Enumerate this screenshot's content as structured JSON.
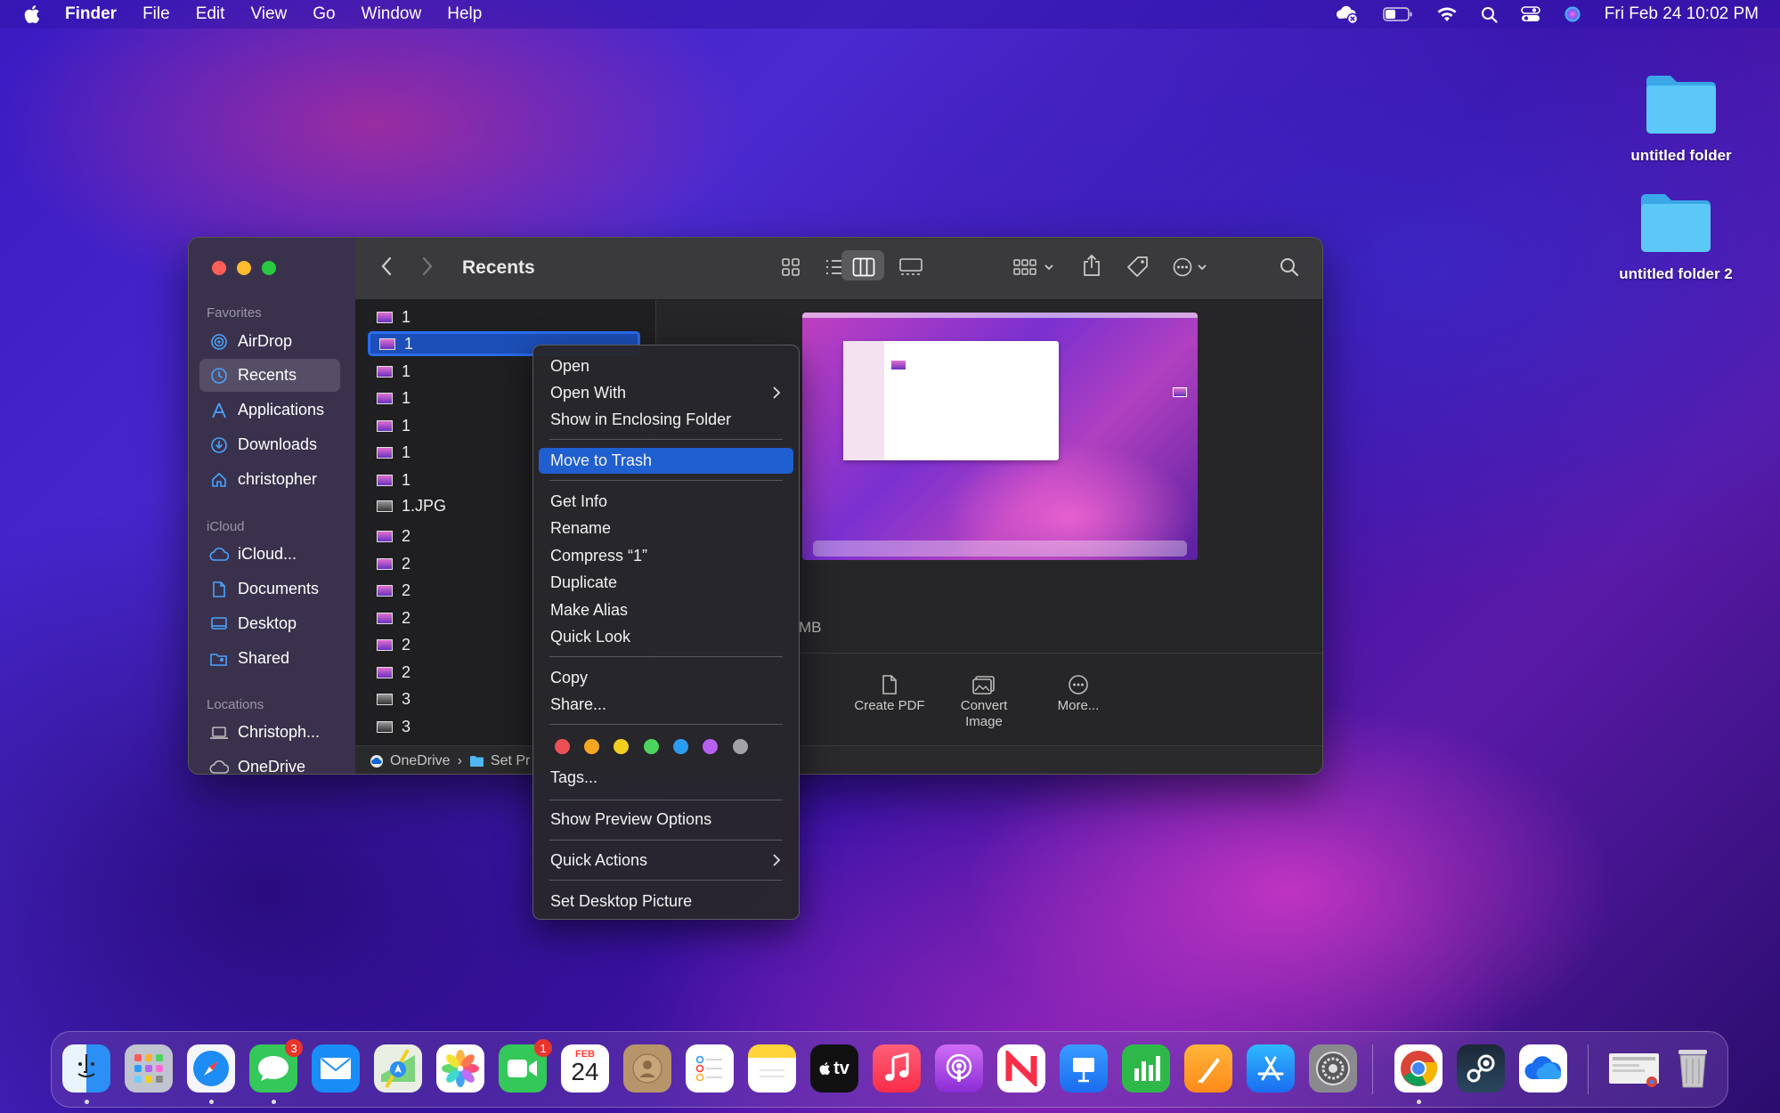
{
  "menubar": {
    "app_name": "Finder",
    "menus": [
      "File",
      "Edit",
      "View",
      "Go",
      "Window",
      "Help"
    ],
    "clock": "Fri Feb 24  10:02 PM"
  },
  "desktop": {
    "folders": [
      "untitled folder",
      "untitled folder 2"
    ]
  },
  "finder": {
    "title": "Recents",
    "sidebar": {
      "sections": {
        "favorites": "Favorites",
        "icloud": "iCloud",
        "locations": "Locations"
      },
      "favorites": [
        "AirDrop",
        "Recents",
        "Applications",
        "Downloads",
        "christopher"
      ],
      "icloud": [
        "iCloud...",
        "Documents",
        "Desktop",
        "Shared"
      ],
      "locations": [
        "Christoph...",
        "OneDrive"
      ]
    },
    "files": [
      "1",
      "1",
      "1",
      "1",
      "1",
      "1",
      "1",
      "1.JPG",
      "2",
      "2",
      "2",
      "2",
      "2",
      "2",
      "3",
      "3"
    ],
    "pathbar": {
      "root": "OneDrive",
      "separator": "›",
      "child": "Set Pr"
    },
    "preview": {
      "info_fragment": "MB",
      "actions": [
        "Create PDF",
        "Convert\nImage",
        "More..."
      ]
    }
  },
  "context_menu": {
    "group1": [
      "Open",
      "Open With",
      "Show in Enclosing Folder"
    ],
    "group2": [
      "Move to Trash"
    ],
    "group3": [
      "Get Info",
      "Rename",
      "Compress “1”",
      "Duplicate",
      "Make Alias",
      "Quick Look"
    ],
    "group4": [
      "Copy",
      "Share..."
    ],
    "tags_label": "Tags...",
    "tag_colors": [
      "#ee4f57",
      "#f5a623",
      "#f2cf1f",
      "#4cd45e",
      "#2b9cf2",
      "#b661f2",
      "#a1a1a6"
    ],
    "show_preview_options": "Show Preview Options",
    "quick_actions": "Quick Actions",
    "set_desktop_picture": "Set Desktop Picture"
  },
  "dock": {
    "calendar_month": "FEB",
    "calendar_day": "24",
    "messages_badge": "3",
    "facetime_badge": "1",
    "tv_label": "tv"
  }
}
